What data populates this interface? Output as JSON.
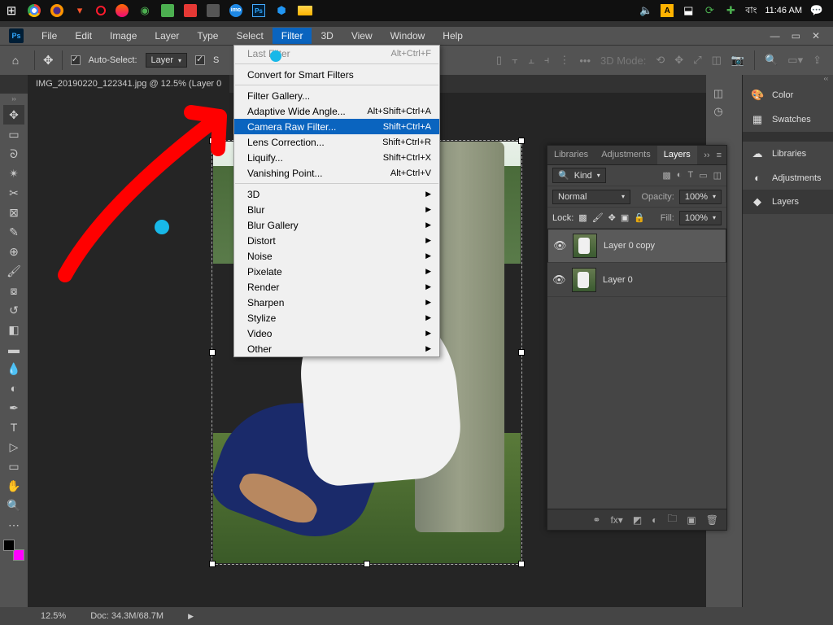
{
  "taskbar": {
    "time": "11:46 AM",
    "lang": "বাং"
  },
  "menubar": {
    "items": [
      "File",
      "Edit",
      "Image",
      "Layer",
      "Type",
      "Select",
      "Filter",
      "3D",
      "View",
      "Window",
      "Help"
    ],
    "open_index": 6
  },
  "optbar": {
    "auto_select": "Auto-Select:",
    "target": "Layer",
    "show_transform": "S",
    "mode3d": "3D Mode:"
  },
  "doctab": {
    "title": "IMG_20190220_122341.jpg @ 12.5% (Layer 0"
  },
  "filter_menu": {
    "last": {
      "label": "Last Filter",
      "shortcut": "Alt+Ctrl+F",
      "disabled": true
    },
    "convert": {
      "label": "Convert for Smart Filters"
    },
    "gallery": {
      "label": "Filter Gallery..."
    },
    "adaptive": {
      "label": "Adaptive Wide Angle...",
      "shortcut": "Alt+Shift+Ctrl+A"
    },
    "camera_raw": {
      "label": "Camera Raw Filter...",
      "shortcut": "Shift+Ctrl+A"
    },
    "lens": {
      "label": "Lens Correction...",
      "shortcut": "Shift+Ctrl+R"
    },
    "liquify": {
      "label": "Liquify...",
      "shortcut": "Shift+Ctrl+X"
    },
    "vanish": {
      "label": "Vanishing Point...",
      "shortcut": "Alt+Ctrl+V"
    },
    "subs": [
      "3D",
      "Blur",
      "Blur Gallery",
      "Distort",
      "Noise",
      "Pixelate",
      "Render",
      "Sharpen",
      "Stylize",
      "Video",
      "Other"
    ]
  },
  "panels": {
    "color": "Color",
    "swatches": "Swatches",
    "libraries": "Libraries",
    "adjustments": "Adjustments",
    "layers": "Layers"
  },
  "layers_panel": {
    "tabs": [
      "Libraries",
      "Adjustments",
      "Layers"
    ],
    "kind": "Kind",
    "blend": "Normal",
    "opacity_label": "Opacity:",
    "opacity_val": "100%",
    "lock_label": "Lock:",
    "fill_label": "Fill:",
    "fill_val": "100%",
    "layers": [
      {
        "name": "Layer 0 copy",
        "selected": true
      },
      {
        "name": "Layer 0",
        "selected": false
      }
    ]
  },
  "status": {
    "zoom": "12.5%",
    "doc": "Doc: 34.3M/68.7M"
  }
}
